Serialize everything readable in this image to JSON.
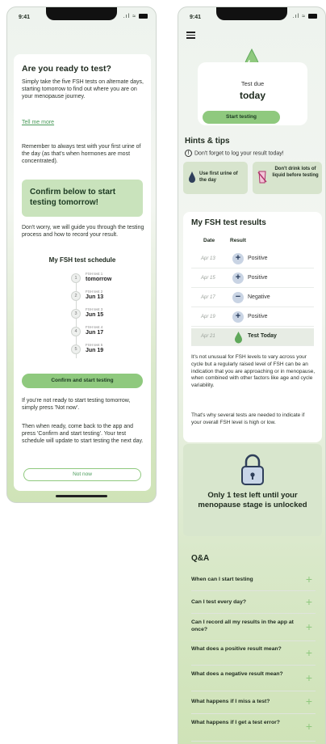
{
  "status": {
    "time": "9:41",
    "signal": ".ıl",
    "wifi": "≈"
  },
  "left_screen": {
    "title": "Are you ready to test?",
    "intro": "Simply take the five FSH tests on alternate days, starting tomorrow to find out where you are on your menopause journey.",
    "tell_more_link": "Tell me more",
    "first_urine_note": "Remember to always test with your first urine of the day (as that's when hormones are most concentrated).",
    "confirm_box": "Confirm below to start testing tomorrow!",
    "guide_note": "Don't worry, we will guide you through the testing process and how to record your result.",
    "schedule_title": "My FSH test schedule",
    "schedule": [
      {
        "num": "1",
        "label": "FSH test 1",
        "date": "tomorrow"
      },
      {
        "num": "2",
        "label": "FSH test 2",
        "date": "Jun 13"
      },
      {
        "num": "3",
        "label": "FSH test 3",
        "date": "Jun 15"
      },
      {
        "num": "4",
        "label": "FSH test 4",
        "date": "Jun 17"
      },
      {
        "num": "5",
        "label": "FSH test 5",
        "date": "Jun 19"
      }
    ],
    "confirm_button": "Confirm and start testing",
    "not_ready_note": "If you're not ready to start testing tomorrow, simply press 'Not now'.",
    "come_back_note": "Then when ready, come back to the app and press 'Confirm and start testing'. Your test schedule will update to start testing the next day.",
    "not_now_button": "Not now"
  },
  "right_screen": {
    "test_due_label": "Test due",
    "test_due_value": "today",
    "start_button": "Start testing",
    "hints_title": "Hints & tips",
    "hints_note": "Don't forget to log your result today!",
    "tip_1": "Use first urine of the day",
    "tip_2": "Don't drink lots of liquid before testing",
    "results_title": "My FSH test results",
    "col_date": "Date",
    "col_result": "Result",
    "results": [
      {
        "date": "Apr 13",
        "result": "Positive",
        "symbol": "+"
      },
      {
        "date": "Apr 15",
        "result": "Positive",
        "symbol": "+"
      },
      {
        "date": "Apr 17",
        "result": "Negative",
        "symbol": "−"
      },
      {
        "date": "Apr 19",
        "result": "Positive",
        "symbol": "+"
      },
      {
        "date": "Apr 21",
        "result": "Test Today",
        "symbol": ""
      }
    ],
    "explanation_1": "It's not unusual for FSH levels to vary across your cycle but a regularly raised level of FSH can be an indication that you are approaching or in menopause, when combined with other factors like age and cycle variability.",
    "explanation_2": "That's why several tests are needed to indicate if your overall FSH level is high or low.",
    "unlock_text": "Only 1 test left until your menopause stage is unlocked",
    "qa_title": "Q&A",
    "qa": [
      "When can I start testing",
      "Can I test every day?",
      "Can I record all my results in the app at once?",
      "What does a positive result mean?",
      "What does a negative result mean?",
      "What happens if I miss a test?",
      "What happens if I get a test error?"
    ]
  },
  "colors": {
    "accent_green": "#8fc97e",
    "box_green": "#c9e3bc",
    "tip_bg": "#d7e4cd",
    "link_green": "#4a9b5a"
  }
}
